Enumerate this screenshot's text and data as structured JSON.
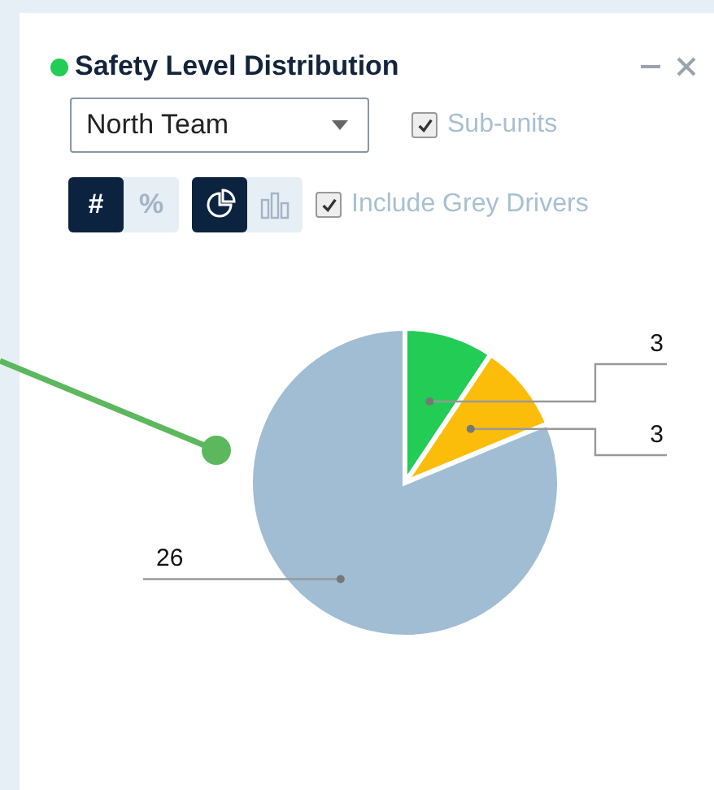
{
  "header": {
    "title": "Safety Level Distribution"
  },
  "team_select": {
    "value": "North Team"
  },
  "sub_units": {
    "label": "Sub-units",
    "checked": true
  },
  "value_mode": [
    {
      "label": "#",
      "selected": true
    },
    {
      "label": "%",
      "selected": false
    }
  ],
  "chart_mode": [
    {
      "kind": "pie",
      "selected": true
    },
    {
      "kind": "bar",
      "selected": false
    }
  ],
  "grey_drivers": {
    "label": "Include Grey Drivers",
    "checked": true
  },
  "chart_data": {
    "type": "pie",
    "values": [
      3,
      3,
      26
    ],
    "colors": [
      "#22cc55",
      "#fbbd0a",
      "#a1bdd4"
    ],
    "data_labels": true
  }
}
